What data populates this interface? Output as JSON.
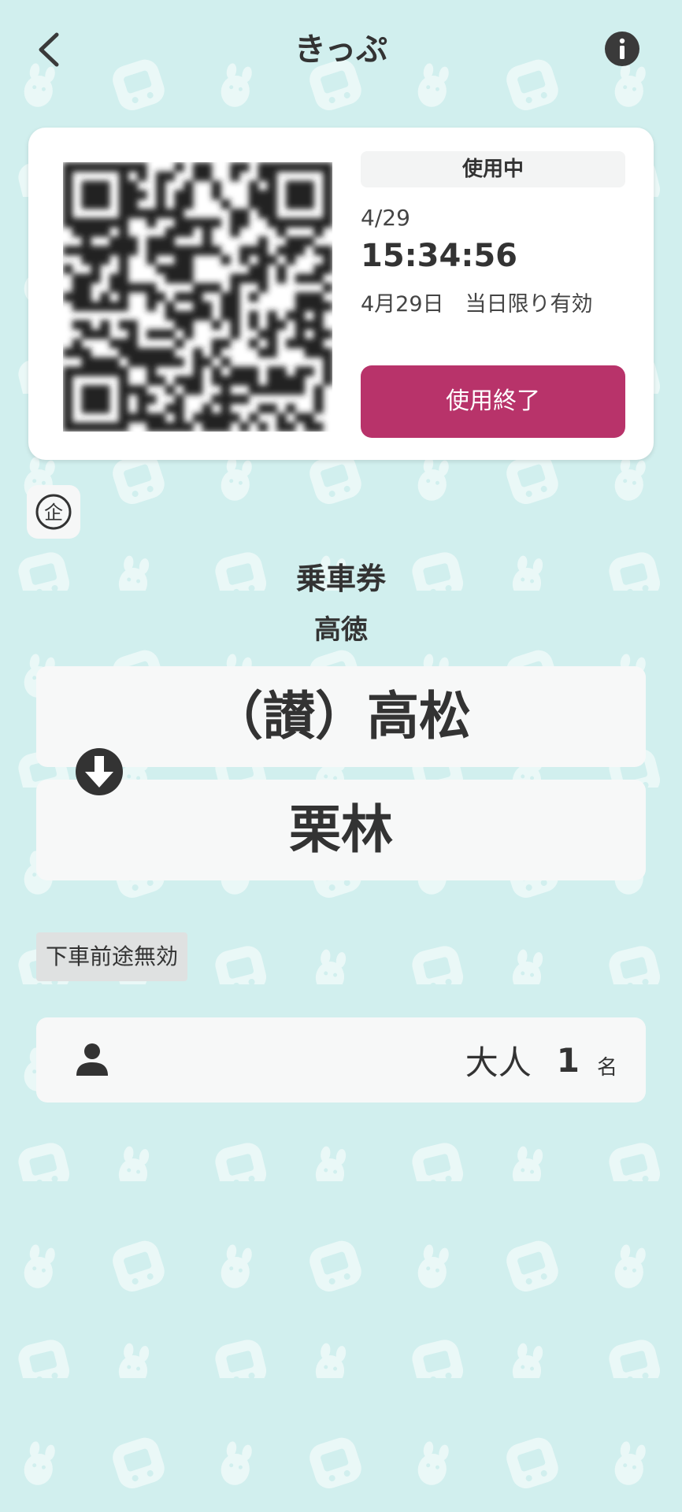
{
  "header": {
    "title": "きっぷ",
    "back_icon": "chevron-left-icon",
    "info_icon": "info-icon"
  },
  "ticket": {
    "status": "使用中",
    "date": "4/29",
    "time": "15:34:56",
    "validity": "4月29日　当日限り有効",
    "end_button_label": "使用終了",
    "qr_icon": "qr-code-icon"
  },
  "company_badge": {
    "icon": "company-mark-icon",
    "mark": "企"
  },
  "route": {
    "ticket_type": "乗車券",
    "line": "高徳",
    "from": "（讃）高松",
    "to": "栗林",
    "direction_icon": "arrow-down-circle-icon"
  },
  "restriction": "下車前途無効",
  "passengers": {
    "icon": "person-icon",
    "type": "大人",
    "count": "1",
    "unit": "名"
  },
  "colors": {
    "background": "#d1efee",
    "accent": "#b8336a",
    "card": "#ffffff",
    "text": "#333333"
  }
}
